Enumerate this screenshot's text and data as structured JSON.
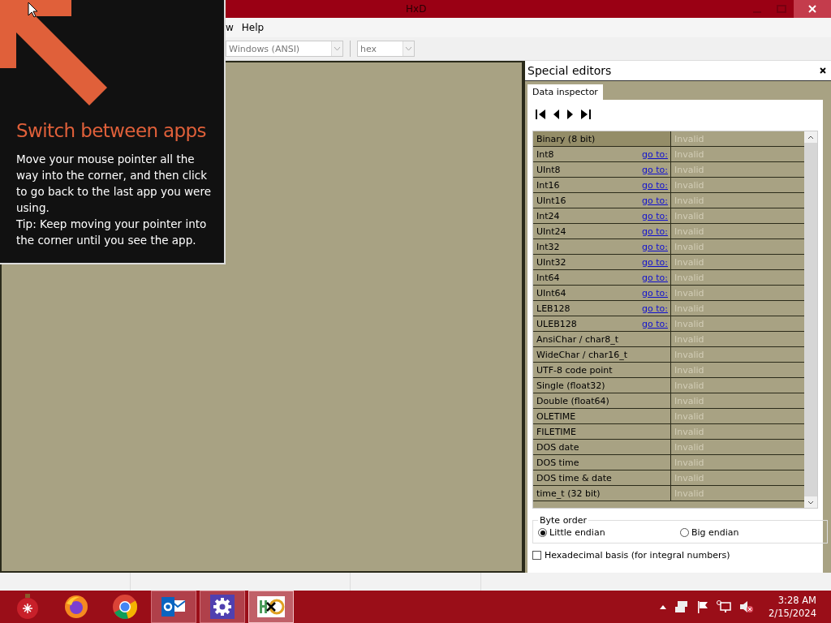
{
  "window": {
    "title": "HxD"
  },
  "menu": [
    {
      "label": "w"
    },
    {
      "label": "Help"
    }
  ],
  "toolbar": {
    "dropdowns": [
      {
        "value": "Windows (ANSI)"
      },
      {
        "value": "hex"
      }
    ]
  },
  "special_editors": {
    "title": "Special editors",
    "tabs": [
      {
        "label": "Data inspector",
        "selected": true
      }
    ],
    "rows": [
      {
        "name": "Binary (8 bit)",
        "value": "Invalid",
        "selected": true
      },
      {
        "name": "Int8",
        "link": "go to:",
        "value": "Invalid",
        "selected": false
      },
      {
        "name": "UInt8",
        "link": "go to:",
        "value": "Invalid",
        "selected": false
      },
      {
        "name": "Int16",
        "link": "go to:",
        "value": "Invalid",
        "selected": false
      },
      {
        "name": "UInt16",
        "link": "go to:",
        "value": "Invalid",
        "selected": false
      },
      {
        "name": "Int24",
        "link": "go to:",
        "value": "Invalid",
        "selected": false
      },
      {
        "name": "UInt24",
        "link": "go to:",
        "value": "Invalid",
        "selected": false
      },
      {
        "name": "Int32",
        "link": "go to:",
        "value": "Invalid",
        "selected": false
      },
      {
        "name": "UInt32",
        "link": "go to:",
        "value": "Invalid",
        "selected": false
      },
      {
        "name": "Int64",
        "link": "go to:",
        "value": "Invalid",
        "selected": false
      },
      {
        "name": "UInt64",
        "link": "go to:",
        "value": "Invalid",
        "selected": false
      },
      {
        "name": "LEB128",
        "link": "go to:",
        "value": "Invalid",
        "selected": false
      },
      {
        "name": "ULEB128",
        "link": "go to:",
        "value": "Invalid",
        "selected": false
      },
      {
        "name": "AnsiChar / char8_t",
        "value": "Invalid",
        "selected": false
      },
      {
        "name": "WideChar / char16_t",
        "value": "Invalid",
        "selected": false
      },
      {
        "name": "UTF-8 code point",
        "value": "Invalid",
        "selected": false
      },
      {
        "name": "Single (float32)",
        "value": "Invalid",
        "selected": false
      },
      {
        "name": "Double (float64)",
        "value": "Invalid",
        "selected": false
      },
      {
        "name": "OLETIME",
        "value": "Invalid",
        "selected": false
      },
      {
        "name": "FILETIME",
        "value": "Invalid",
        "selected": false
      },
      {
        "name": "DOS date",
        "value": "Invalid",
        "selected": false
      },
      {
        "name": "DOS time",
        "value": "Invalid",
        "selected": false
      },
      {
        "name": "DOS time & date",
        "value": "Invalid",
        "selected": false
      },
      {
        "name": "time_t (32 bit)",
        "value": "Invalid",
        "selected": false
      }
    ],
    "byte_order": {
      "label": "Byte order",
      "options": [
        {
          "label": "Little endian",
          "selected": true
        },
        {
          "label": "Big endian",
          "selected": false
        }
      ]
    },
    "hex_basis": {
      "label": "Hexadecimal basis (for integral numbers)",
      "checked": false
    }
  },
  "taskbar": {
    "apps": [
      {
        "kind": "ornament",
        "running": false,
        "active": false
      },
      {
        "kind": "firefox",
        "running": false,
        "active": false
      },
      {
        "kind": "chrome",
        "running": false,
        "active": false
      },
      {
        "kind": "mail",
        "running": true,
        "active": false
      },
      {
        "kind": "settings",
        "running": true,
        "active": false
      },
      {
        "kind": "hexeditor",
        "running": true,
        "active": true
      }
    ],
    "clock": {
      "time": "3:28 AM",
      "date": "2/15/2024"
    }
  },
  "overlay": {
    "title": "Switch between apps",
    "text": "Move your mouse pointer all the way into the corner, and then click to go back to the last app you were using.",
    "tip": "Tip: Keep moving your pointer into the corner until you see the app."
  }
}
